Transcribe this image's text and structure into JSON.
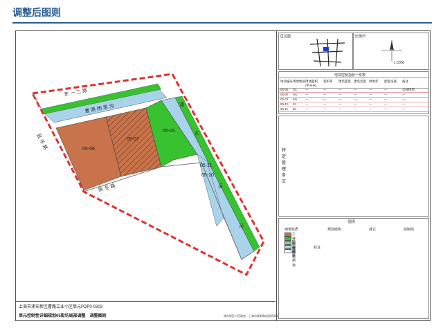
{
  "page_title": "调整后图则",
  "map": {
    "parcels": [
      {
        "id": "05-06",
        "use_color": "#c8734a"
      },
      {
        "id": "05-07",
        "use_color": "#c8734a"
      },
      {
        "id": "05-05",
        "use_color": "#39c230"
      },
      {
        "id": "05-11",
        "use_color": "#a8d3ea"
      },
      {
        "id": "05-10",
        "use_color": "#a8d3ea"
      }
    ],
    "labels": {
      "road_north": "东 一 二 路",
      "river_north": "曹 路 杨 家 沟",
      "road_south": "陈 冬 路",
      "road_west": "民 乐 路",
      "river_east_1": "浦",
      "river_east_2": "东",
      "river_east_3": "运",
      "river_east_4": "河"
    }
  },
  "panels": {
    "location_label": "区位图",
    "scale_label": "比例尺",
    "scale_value": "1:3000",
    "table_title": "地块控制指标一览表",
    "table_headers": [
      "地块编号",
      "用地性质",
      "用地面积(平方米)",
      "容积率",
      "建筑密度",
      "建筑高度",
      "绿地率",
      "配套设施",
      "备注"
    ],
    "table_rows": [
      [
        "05-05",
        "G1",
        "—",
        "—",
        "—",
        "—",
        "—",
        "—",
        "公园绿地"
      ],
      [
        "05-06",
        "M1",
        "—",
        "—",
        "—",
        "—",
        "—",
        "—",
        "—"
      ],
      [
        "05-07",
        "M1",
        "—",
        "—",
        "—",
        "—",
        "—",
        "—",
        "—"
      ],
      [
        "05-10",
        "E1",
        "—",
        "—",
        "—",
        "—",
        "—",
        "—",
        "—"
      ],
      [
        "05-11",
        "E1",
        "—",
        "—",
        "—",
        "—",
        "—",
        "—",
        "—"
      ]
    ],
    "special_label": "特定管理条文",
    "legend_title": "图例",
    "legend_groups": [
      "用地性质",
      "规划结构",
      "其它",
      "控制线"
    ],
    "legend_items": [
      {
        "name": "工业用地",
        "color": "#c8734a"
      },
      {
        "name": "公园绿地",
        "color": "#39c230"
      },
      {
        "name": "防护绿地",
        "color": "#8fd17a"
      },
      {
        "name": "水域",
        "color": "#a8d3ea"
      },
      {
        "name": "道路用地",
        "color": "#ffffff"
      }
    ],
    "legend_sub_title": "标注"
  },
  "footer": {
    "line1": "上海市浦东新区曹路工业小区单元PDP0-0303",
    "line2": "单元控制性详细规划05街坊局部调整　调整图则",
    "org": "浦东新区人民政府、上海市规划和自然资源局"
  }
}
